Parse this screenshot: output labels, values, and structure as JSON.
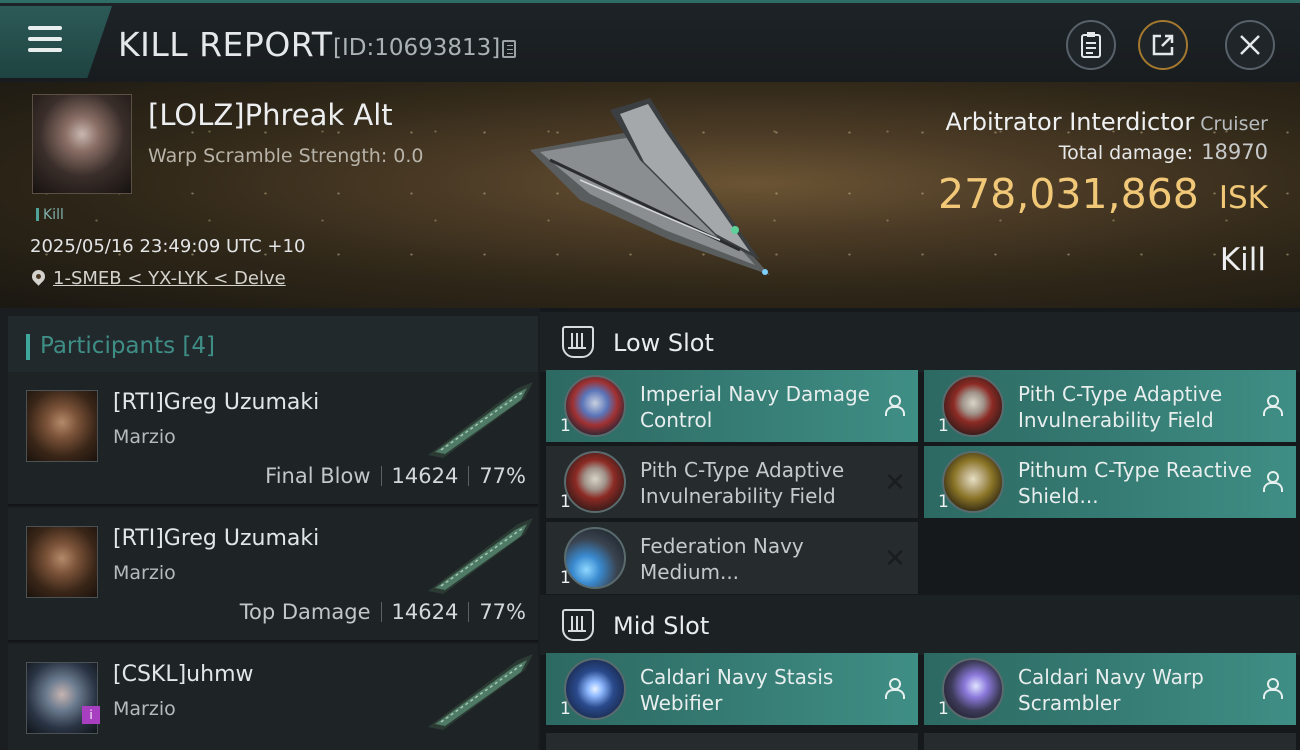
{
  "header": {
    "title": "KILL REPORT",
    "report_id": "[ID:10693813]"
  },
  "victim": {
    "name": "[LOLZ]Phreak Alt",
    "warp_scramble": "Warp Scramble Strength: 0.0",
    "kill_tag": "Kill",
    "datetime": "2025/05/16 23:49:09 UTC +10",
    "location": "1-SMEB < YX-LYK < Delve",
    "ship_name": "Arbitrator Interdictor",
    "ship_class": "Cruiser",
    "total_damage_label": "Total damage:",
    "total_damage": "18970",
    "isk_value": "278,031,868",
    "isk_unit": "ISK",
    "result": "Kill"
  },
  "participants": {
    "label": "Participants",
    "count": "[4]",
    "items": [
      {
        "name": "[RTI]Greg Uzumaki",
        "corp": "Marzio",
        "role": "Final Blow",
        "damage": "14624",
        "percent": "77%"
      },
      {
        "name": "[RTI]Greg Uzumaki",
        "corp": "Marzio",
        "role": "Top Damage",
        "damage": "14624",
        "percent": "77%"
      },
      {
        "name": "[CSKL]uhmw",
        "corp": "Marzio",
        "badge": "i"
      }
    ]
  },
  "low_slot": {
    "title": "Low Slot",
    "modules": [
      {
        "name": "Imperial Navy Damage Control",
        "qty": "1",
        "state": "dropped",
        "icon": "damage-control"
      },
      {
        "name": "Pith C-Type Adaptive Invulnerability Field",
        "qty": "1",
        "state": "dropped",
        "icon": "shield-hardener"
      },
      {
        "name": "Pith C-Type Adaptive Invulnerability Field",
        "qty": "1",
        "state": "destroyed",
        "icon": "shield-hardener"
      },
      {
        "name": "Pithum C-Type Reactive Shield...",
        "qty": "1",
        "state": "dropped",
        "icon": "shield-hardener-gold"
      },
      {
        "name": "Federation Navy Medium...",
        "qty": "1",
        "state": "destroyed",
        "icon": "booster"
      }
    ]
  },
  "mid_slot": {
    "title": "Mid Slot",
    "modules": [
      {
        "name": "Caldari Navy Stasis Webifier",
        "qty": "1",
        "state": "dropped",
        "icon": "stasis-webifier"
      },
      {
        "name": "Caldari Navy Warp Scrambler",
        "qty": "1",
        "state": "dropped",
        "icon": "warp-scrambler"
      }
    ]
  },
  "colors": {
    "accent": "#3f8e85",
    "isk": "#f0c878"
  }
}
